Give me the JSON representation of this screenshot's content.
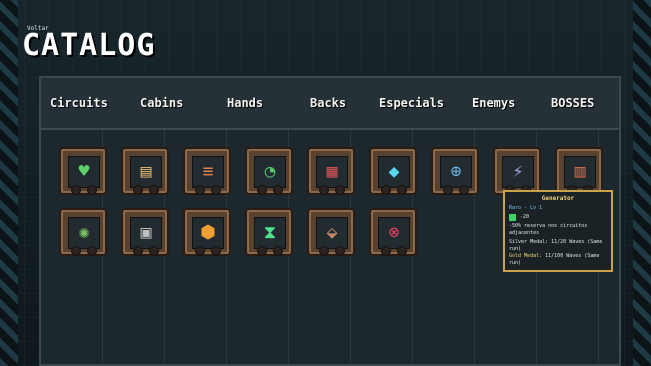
{
  "header": {
    "back_label": "Voltar",
    "title": "CATALOG"
  },
  "tabs": [
    "Circuits",
    "Cabins",
    "Hands",
    "Backs",
    "Especials",
    "Enemys",
    "BOSSES"
  ],
  "items": [
    {
      "icon": "circuit-chip-icon",
      "glyph": "♥",
      "color": "#5bd06c"
    },
    {
      "icon": "book-chip-icon",
      "glyph": "▤",
      "color": "#d8b070"
    },
    {
      "icon": "battery-rack-icon",
      "glyph": "≡",
      "color": "#e08050"
    },
    {
      "icon": "radar-icon",
      "glyph": "◔",
      "color": "#4fc86a"
    },
    {
      "icon": "control-panel-icon",
      "glyph": "▦",
      "color": "#c85050"
    },
    {
      "icon": "crystal-core-icon",
      "glyph": "◆",
      "color": "#58d8f0"
    },
    {
      "icon": "target-chip-icon",
      "glyph": "⊕",
      "color": "#6ab0e0"
    },
    {
      "icon": "generator-icon",
      "glyph": "⚡",
      "color": "#a8a0f0"
    },
    {
      "icon": "grate-icon",
      "glyph": "▥",
      "color": "#c06a48"
    },
    {
      "icon": "fan-icon",
      "glyph": "✺",
      "color": "#7ac060"
    },
    {
      "icon": "weight-chip-icon",
      "glyph": "▣",
      "color": "#c0c0c0"
    },
    {
      "icon": "hex-core-icon",
      "glyph": "⬢",
      "color": "#f0a030"
    },
    {
      "icon": "hourglass-icon",
      "glyph": "⧗",
      "color": "#4fe08a"
    },
    {
      "icon": "armor-plate-icon",
      "glyph": "⬙",
      "color": "#c08a6a"
    },
    {
      "icon": "crosshair-chip-icon",
      "glyph": "⊗",
      "color": "#e04060"
    }
  ],
  "tooltip": {
    "name": "Generator",
    "rarity": "Raro - Lv 1",
    "stat": "-20",
    "desc": "-50% reserva nos circuitos adjacentes",
    "silver": "Silver Medal: 11/20 Waves (Same run)",
    "gold_label": "Gold Medal:",
    "gold": "11/100 Waves (Same run)"
  }
}
